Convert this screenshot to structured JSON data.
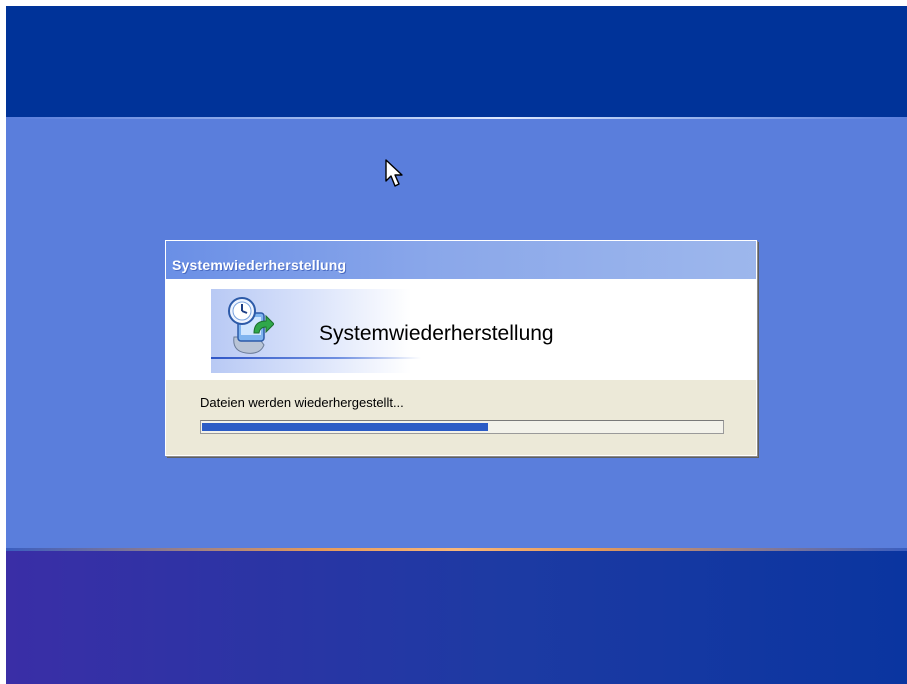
{
  "dialog": {
    "title": "Systemwiederherstellung",
    "banner_title": "Systemwiederherstellung",
    "status_text": "Dateien werden wiederhergestellt...",
    "progress_fraction": 0.55
  },
  "icons": {
    "restore": "system-restore-icon",
    "cursor": "mouse-pointer-icon"
  },
  "colors": {
    "desktop_top": "#003399",
    "desktop_middle": "#5a7edc",
    "progress_fill": "#2c5cc6",
    "dialog_face": "#ece9d8"
  }
}
